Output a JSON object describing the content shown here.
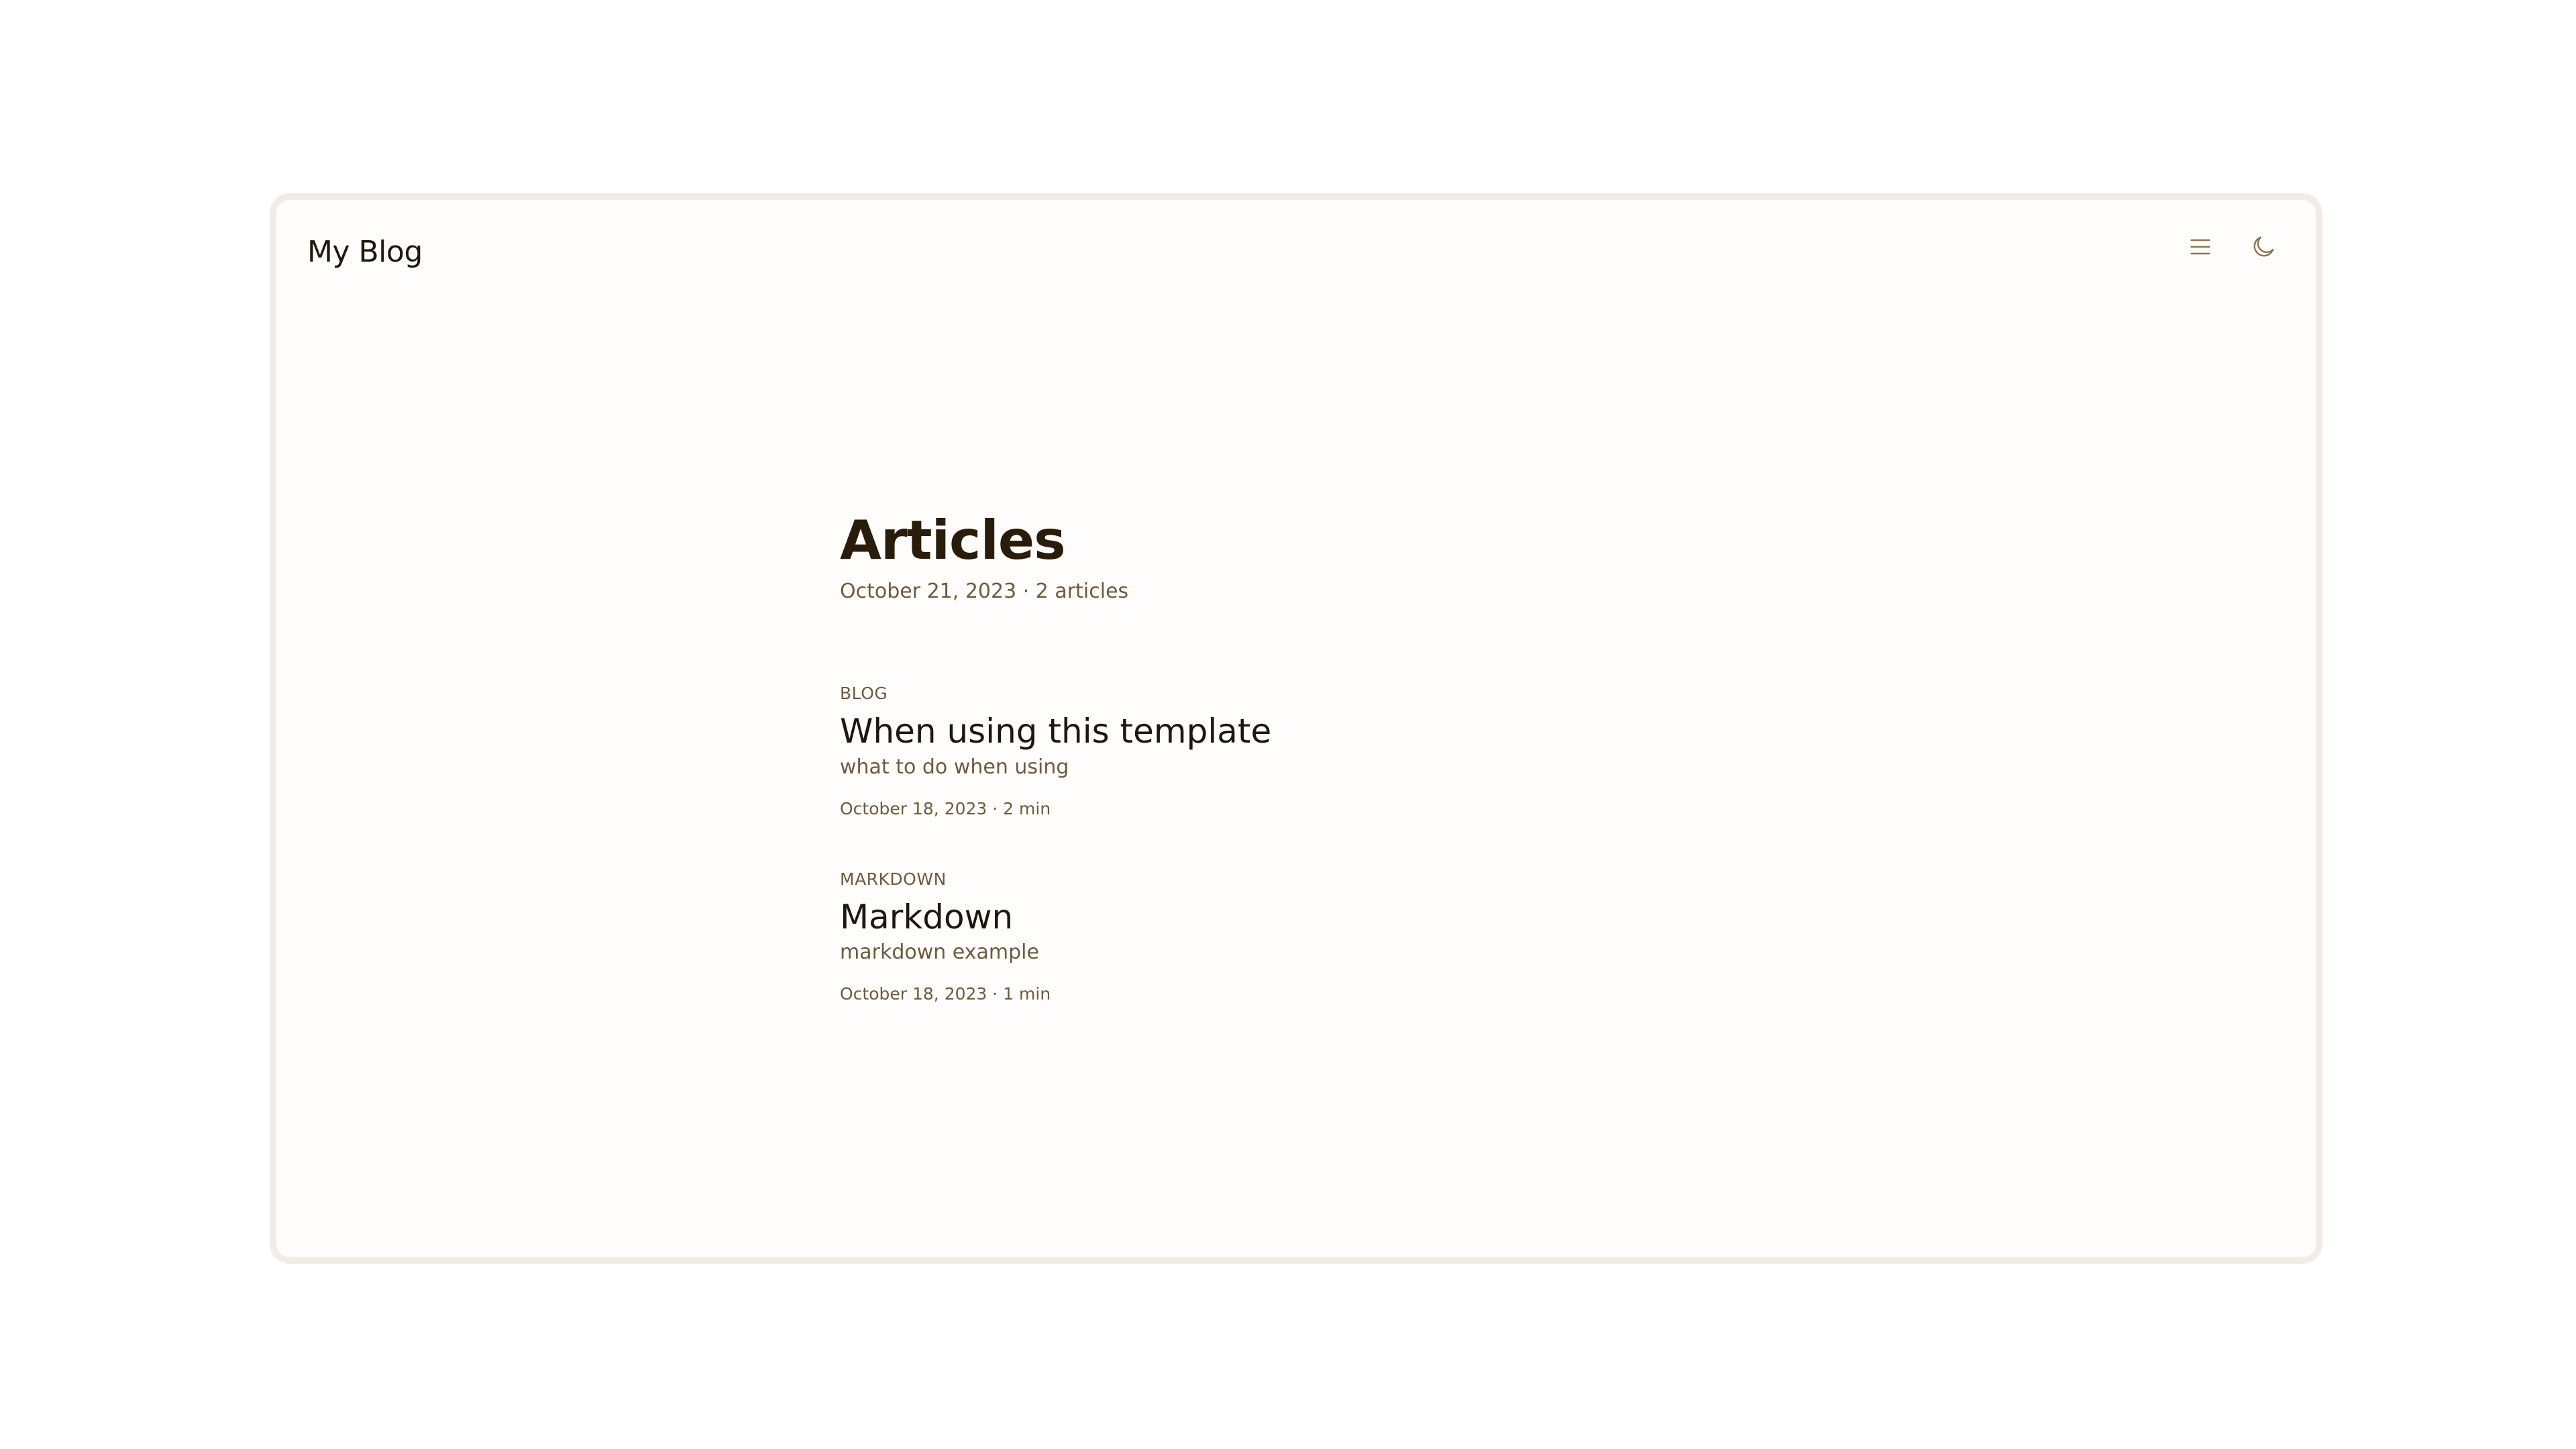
{
  "site": {
    "title": "My Blog"
  },
  "header": {
    "menu_icon": "menu-icon",
    "theme_icon": "moon-icon"
  },
  "main": {
    "title": "Articles",
    "meta": "October 21, 2023 · 2 articles",
    "articles": [
      {
        "category": "BLOG",
        "title": "When using this template",
        "description": "what to do when using",
        "meta": "October 18, 2023 · 2 min"
      },
      {
        "category": "MARKDOWN",
        "title": "Markdown",
        "description": "markdown example",
        "meta": "October 18, 2023 · 1 min"
      }
    ]
  },
  "colors": {
    "frame_border": "#f1ede6",
    "background": "#fffdfb",
    "heading": "#2a1c0a",
    "muted": "#6e5a3c",
    "icon": "#8a7652"
  }
}
